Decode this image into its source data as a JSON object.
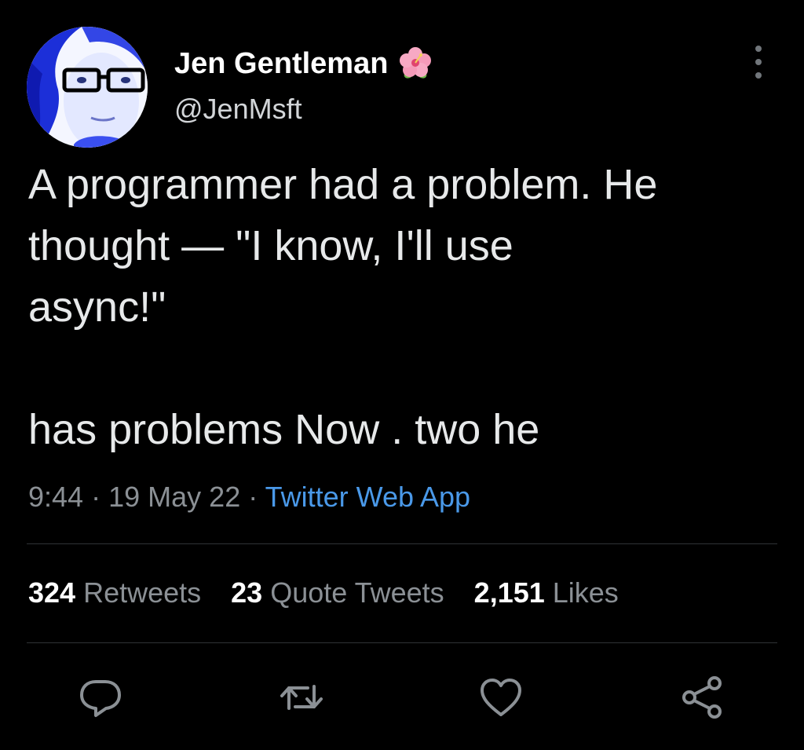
{
  "author": {
    "display_name": "Jen Gentleman",
    "handle": "@JenMsft",
    "avatar_icon": "avatar-photo",
    "badge_icon": "hibiscus-flower-icon"
  },
  "tweet": {
    "lines": [
      "A programmer had a problem. He",
      "thought  — \"I know, I'll use",
      "async!\"",
      "",
      "has problems Now . two he"
    ],
    "time": "9:44",
    "separator": "·",
    "date": "19 May 22",
    "source": "Twitter Web App"
  },
  "stats": {
    "retweets": {
      "count": "324",
      "label": "Retweets"
    },
    "quotes": {
      "count": "23",
      "label": "Quote Tweets"
    },
    "likes": {
      "count": "2,151",
      "label": "Likes"
    }
  },
  "actions": [
    "reply-icon",
    "retweet-icon",
    "like-icon",
    "share-icon"
  ],
  "colors": {
    "background": "#000000",
    "text": "#e7e9ea",
    "muted": "#8b9095",
    "link": "#4a99e9",
    "divider": "#2f3336"
  }
}
